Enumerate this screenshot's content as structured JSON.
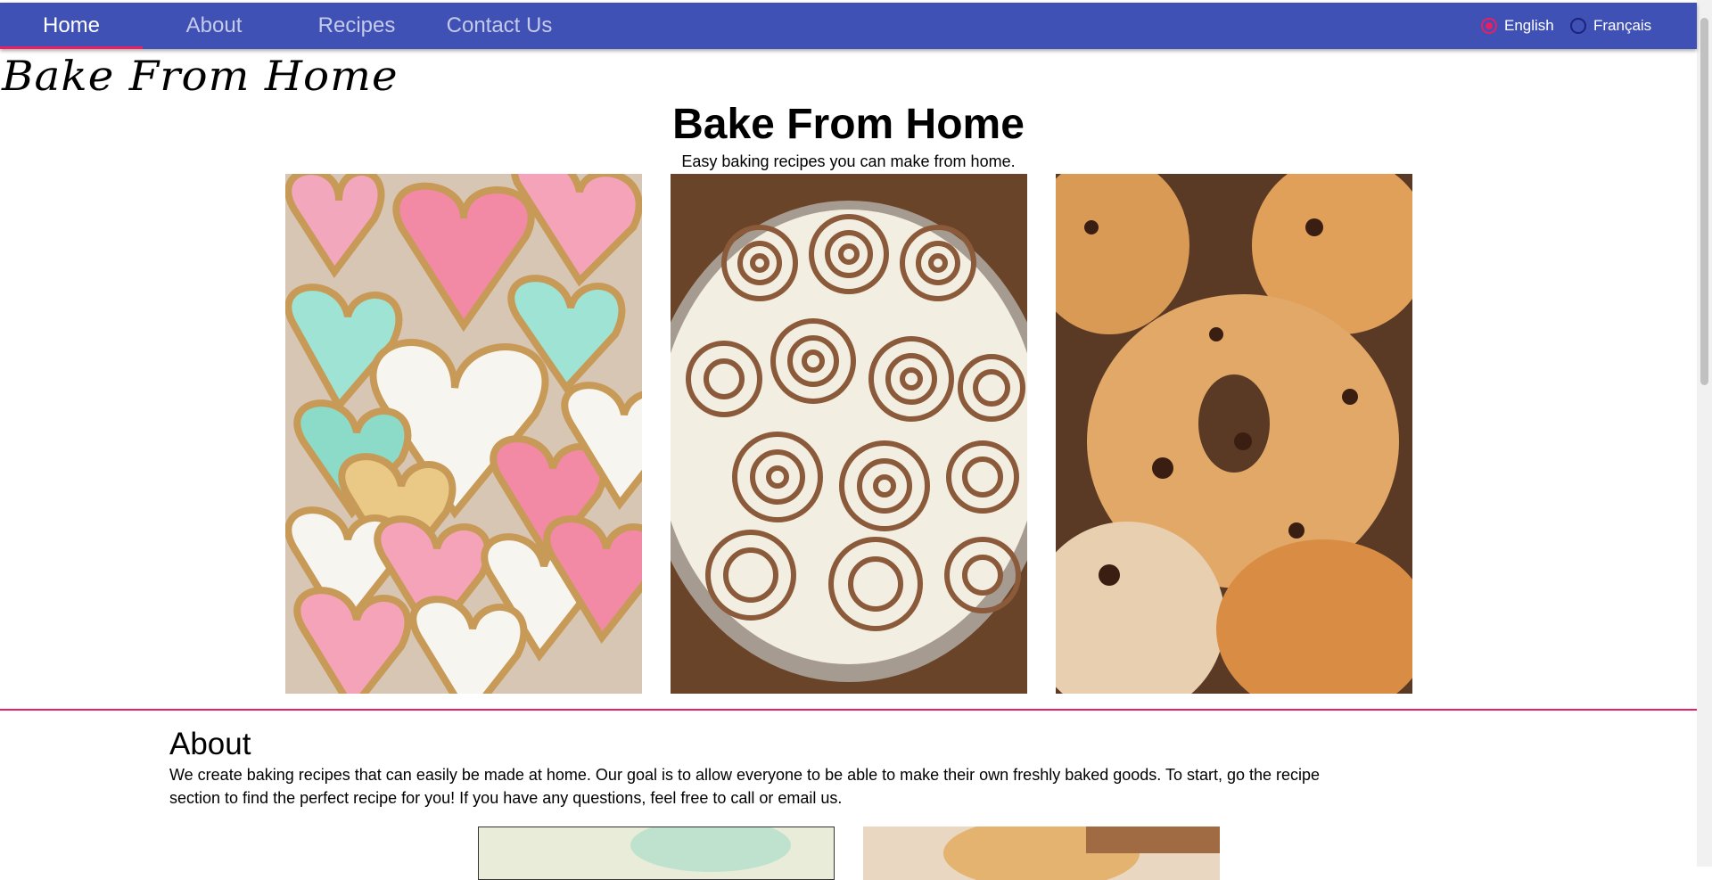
{
  "nav": {
    "tabs": [
      {
        "label": "Home",
        "active": true
      },
      {
        "label": "About",
        "active": false
      },
      {
        "label": "Recipes",
        "active": false
      },
      {
        "label": "Contact Us",
        "active": false
      }
    ],
    "languages": [
      {
        "label": "English",
        "selected": true
      },
      {
        "label": "Français",
        "selected": false
      }
    ],
    "colors": {
      "bar": "#3f51b5",
      "accent": "#e91e63"
    }
  },
  "logo": {
    "text": "Bake From Home"
  },
  "hero": {
    "title": "Bake From Home",
    "subtitle": "Easy baking recipes you can make from home.",
    "images": [
      {
        "name": "heart-sugar-cookies-image"
      },
      {
        "name": "cinnamon-rolls-image"
      },
      {
        "name": "raisin-bagels-image"
      }
    ]
  },
  "about": {
    "heading": "About",
    "text": "We create baking recipes that can easily be made at home. Our goal is to allow everyone to be able to make their own freshly baked goods. To start, go the recipe section to find the perfect recipe for you! If you have any questions, feel free to call or email us."
  }
}
